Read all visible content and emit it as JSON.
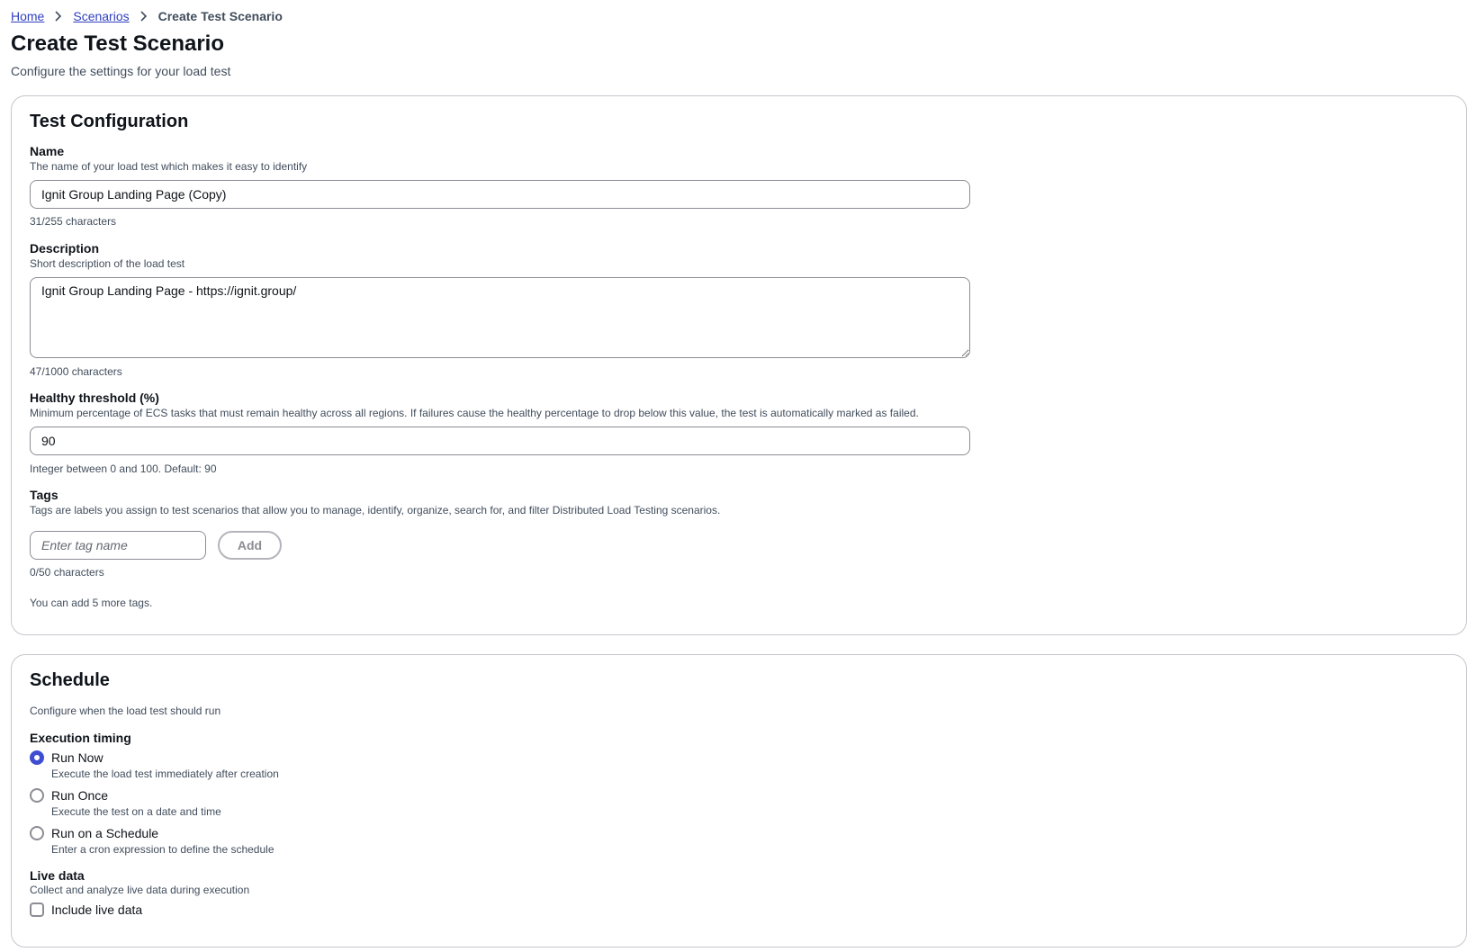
{
  "breadcrumb": {
    "items": [
      "Home",
      "Scenarios"
    ],
    "current": "Create Test Scenario"
  },
  "page": {
    "title": "Create Test Scenario",
    "subtitle": "Configure the settings for your load test"
  },
  "test_configuration": {
    "title": "Test Configuration",
    "name": {
      "label": "Name",
      "description": "The name of your load test which makes it easy to identify",
      "value": "Ignit Group Landing Page (Copy)",
      "counter": "31/255 characters"
    },
    "description": {
      "label": "Description",
      "description": "Short description of the load test",
      "value": "Ignit Group Landing Page - https://ignit.group/",
      "counter": "47/1000 characters"
    },
    "healthy_threshold": {
      "label": "Healthy threshold (%)",
      "description": "Minimum percentage of ECS tasks that must remain healthy across all regions. If failures cause the healthy percentage to drop below this value, the test is automatically marked as failed.",
      "value": "90",
      "hint": "Integer between 0 and 100. Default: 90"
    },
    "tags": {
      "label": "Tags",
      "description": "Tags are labels you assign to test scenarios that allow you to manage, identify, organize, search for, and filter Distributed Load Testing scenarios.",
      "placeholder": "Enter tag name",
      "add_label": "Add",
      "counter": "0/50 characters",
      "remaining": "You can add 5 more tags."
    }
  },
  "schedule": {
    "title": "Schedule",
    "description": "Configure when the load test should run",
    "execution_timing": {
      "label": "Execution timing",
      "options": [
        {
          "label": "Run Now",
          "description": "Execute the load test immediately after creation",
          "checked": true
        },
        {
          "label": "Run Once",
          "description": "Execute the test on a date and time",
          "checked": false
        },
        {
          "label": "Run on a Schedule",
          "description": "Enter a cron expression to define the schedule",
          "checked": false
        }
      ]
    },
    "live_data": {
      "label": "Live data",
      "description": "Collect and analyze live data during execution",
      "checkbox_label": "Include live data",
      "checked": false
    }
  },
  "colors": {
    "link": "#2f3fbf",
    "accent": "#3e4dd1",
    "border": "#c6c6cd"
  }
}
